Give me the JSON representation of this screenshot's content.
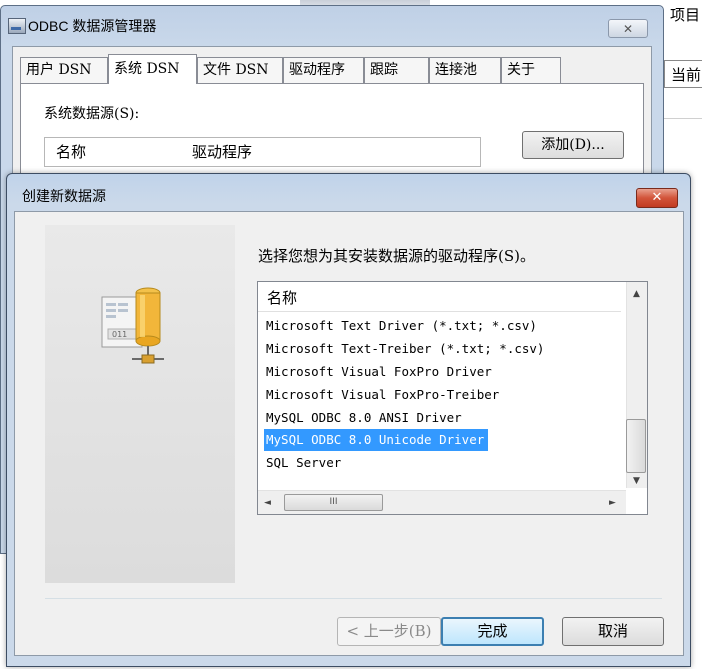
{
  "background": {
    "right_top_text": "项目",
    "right_tab_text": "当前"
  },
  "odbc_window": {
    "title": "ODBC 数据源管理器",
    "close_glyph": "✕",
    "tabs": [
      "用户 DSN",
      "系统 DSN",
      "文件 DSN",
      "驱动程序",
      "跟踪",
      "连接池",
      "关于"
    ],
    "active_tab": "系统 DSN",
    "system_sources_label": "系统数据源(S):",
    "columns": [
      "名称",
      "驱动程序"
    ],
    "add_button": "添加(D)..."
  },
  "dialog": {
    "title": "创建新数据源",
    "close_glyph": "✕",
    "instruction": "选择您想为其安装数据源的驱动程序(S)。",
    "list_header": "名称",
    "drivers": [
      "Microsoft Text Driver (*.txt; *.csv)",
      "Microsoft Text-Treiber (*.txt; *.csv)",
      "Microsoft Visual FoxPro Driver",
      "Microsoft Visual FoxPro-Treiber",
      "MySQL ODBC 8.0 ANSI Driver",
      "MySQL ODBC 8.0 Unicode Driver",
      "SQL Server"
    ],
    "selected_driver": "MySQL ODBC 8.0 Unicode Driver",
    "buttons": {
      "back": "< 上一步(B)",
      "finish": "完成",
      "cancel": "取消"
    },
    "scroll_glyphs": {
      "up": "▲",
      "down": "▼",
      "left": "◄",
      "right": "►",
      "grip": "III"
    }
  }
}
